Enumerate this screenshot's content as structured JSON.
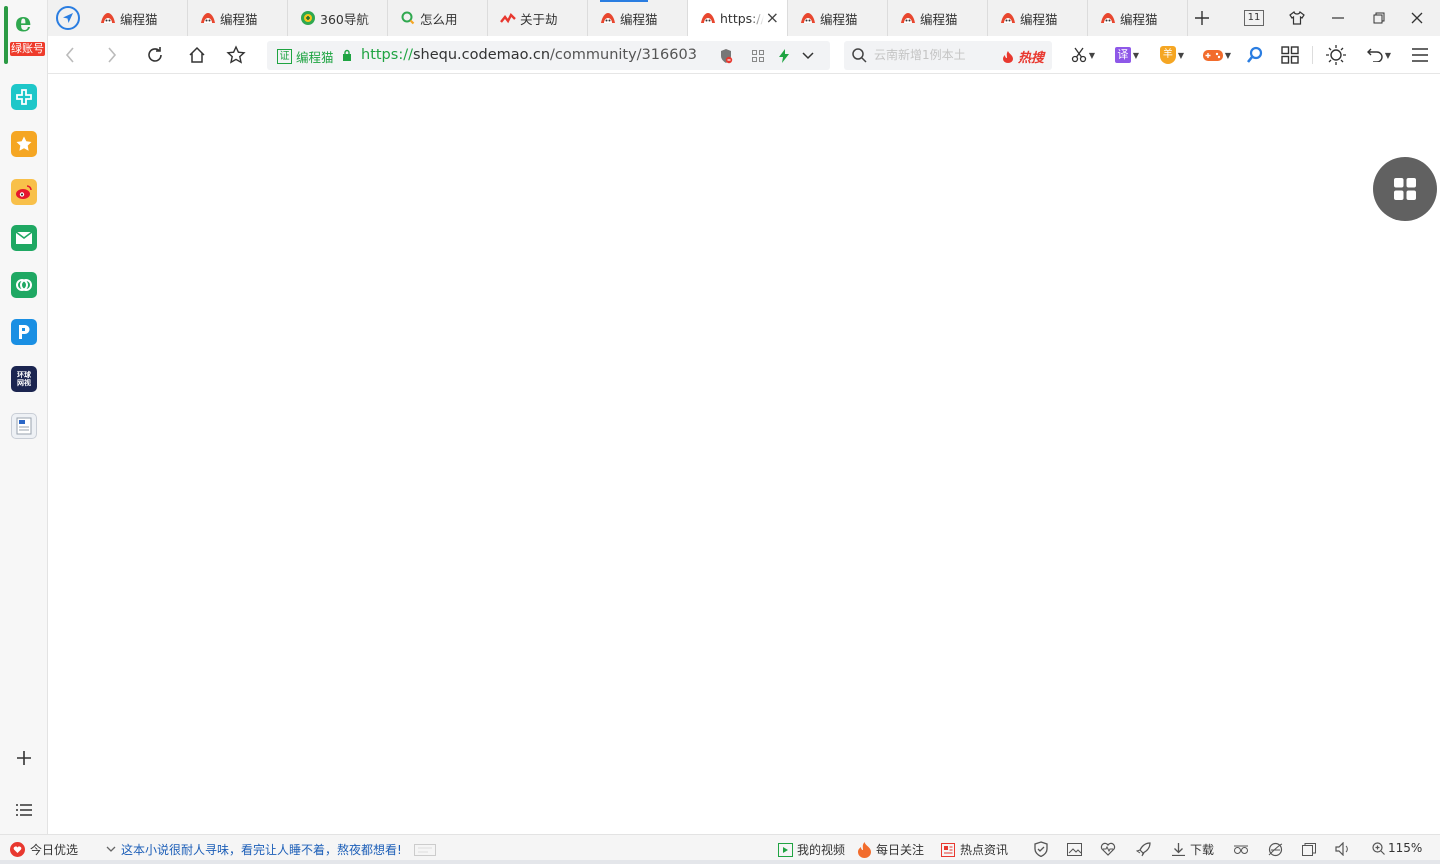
{
  "sidebar": {
    "logo_badge": "绿账号",
    "apps": [
      {
        "name": "medical-app",
        "color": "#1ec7c9"
      },
      {
        "name": "favorites-app",
        "color": "#f5a623"
      },
      {
        "name": "weibo-app",
        "color": "#f5a623"
      },
      {
        "name": "mail-app",
        "color": "#1fa863"
      },
      {
        "name": "link-app",
        "color": "#1fa863"
      },
      {
        "name": "p-app",
        "color": "#1a8fe3"
      },
      {
        "name": "news-app",
        "color": "#1b2550",
        "label": "环球\n网视"
      },
      {
        "name": "doc-app",
        "color": "#e9ecf1"
      }
    ]
  },
  "tabs": [
    {
      "title": "编程猫",
      "favicon": "codemao"
    },
    {
      "title": "编程猫",
      "favicon": "codemao"
    },
    {
      "title": "360导航",
      "favicon": "360"
    },
    {
      "title": "怎么用",
      "favicon": "search"
    },
    {
      "title": "关于劫",
      "favicon": "wave"
    },
    {
      "title": "编程猫",
      "favicon": "codemao"
    },
    {
      "title": "https://shequ.codemao.cn",
      "favicon": "codemao",
      "active": true
    },
    {
      "title": "编程猫",
      "favicon": "codemao"
    },
    {
      "title": "编程猫",
      "favicon": "codemao"
    },
    {
      "title": "编程猫",
      "favicon": "codemao"
    },
    {
      "title": "编程猫",
      "favicon": "codemao"
    }
  ],
  "tab_count": "11",
  "address": {
    "cert_label": "编程猫",
    "cert_box": "证",
    "url_protocol": "https://",
    "url_host": "shequ.codemao.cn",
    "url_path": "/community/316603"
  },
  "search": {
    "placeholder": "云南新增1例本土",
    "hot_label": "热搜"
  },
  "toolbar": {
    "translate_label": "译",
    "shield_label": "羊"
  },
  "statusbar": {
    "today_label": "今日优选",
    "news_text": "这本小说很耐人寻味，看完让人睡不着，熬夜都想看!",
    "video_label": "我的视频",
    "follow_label": "每日关注",
    "hotnews_label": "热点资讯",
    "download_label": "下载",
    "zoom": "115%"
  },
  "colors": {
    "accent": "#2a7de1",
    "secure_green": "#1fa442",
    "hot_red": "#e8382f",
    "codemao_red": "#e8472f"
  }
}
